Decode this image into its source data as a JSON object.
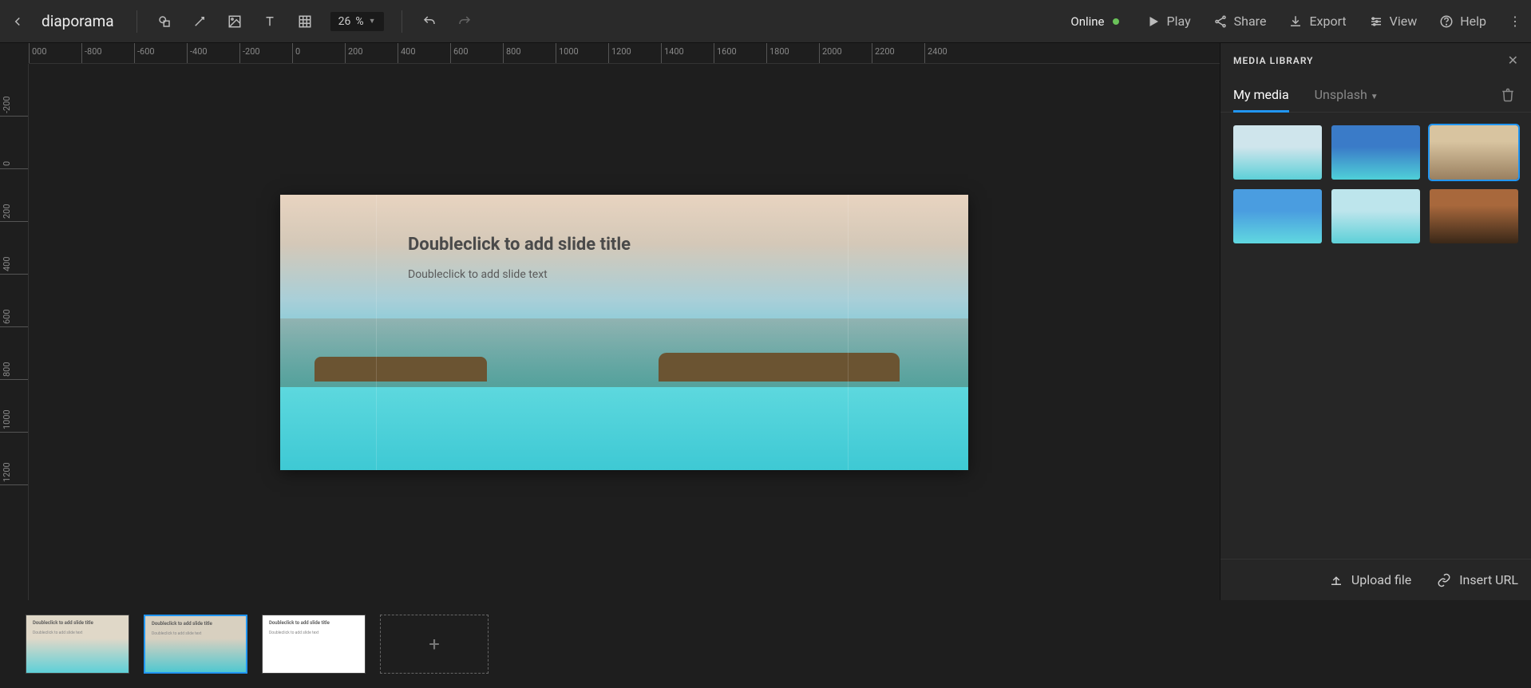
{
  "toolbar": {
    "title": "diaporama",
    "zoom_value": "26",
    "zoom_suffix": "%",
    "status_label": "Online",
    "actions": {
      "play": "Play",
      "share": "Share",
      "export": "Export",
      "view": "View",
      "help": "Help"
    }
  },
  "ruler_h": [
    "000",
    "-800",
    "-600",
    "-400",
    "-200",
    "0",
    "200",
    "400",
    "600",
    "800",
    "1000",
    "1200",
    "1400",
    "1600",
    "1800",
    "2000",
    "2200",
    "2400"
  ],
  "ruler_v": [
    "-200",
    "0",
    "200",
    "400",
    "600",
    "800",
    "1000",
    "1200"
  ],
  "slide": {
    "title_placeholder": "Doubleclick to add slide title",
    "text_placeholder": "Doubleclick to add slide text"
  },
  "panel": {
    "title": "MEDIA LIBRARY",
    "tabs": {
      "my_media": "My media",
      "unsplash": "Unsplash"
    },
    "footer": {
      "upload": "Upload file",
      "insert_url": "Insert URL"
    }
  },
  "thumbs": {
    "t1_title": "Doubleclick to add slide title",
    "t2_title": "Doubleclick to add slide title",
    "t3_title": "Doubleclick to add slide title",
    "sub": "Doubleclick to add slide text"
  }
}
